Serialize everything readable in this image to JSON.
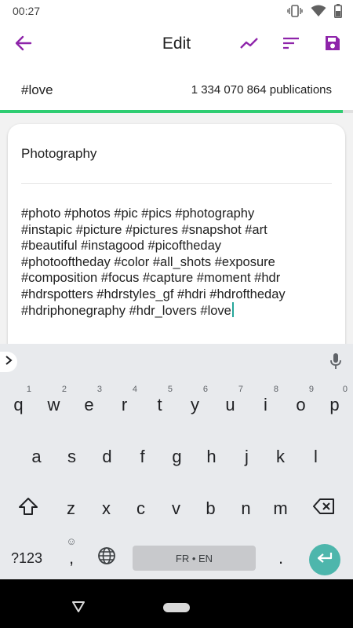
{
  "status_bar": {
    "time": "00:27",
    "icons": [
      "vibrate-icon",
      "wifi-icon",
      "battery-icon"
    ]
  },
  "app_bar": {
    "title": "Edit",
    "accent_color": "#8e24aa",
    "actions": [
      "back-arrow-icon",
      "trending-icon",
      "sort-icon",
      "save-icon"
    ]
  },
  "hashtag": {
    "name": "#love",
    "publications": "1 334 070 864 publications",
    "progress_fraction": 0.97,
    "progress_color": "#2ecc71"
  },
  "card": {
    "title": "Photography",
    "lines": [
      "#photo #photos #pic #pics #photography",
      "#instapic #picture #pictures #snapshot #art",
      "#beautiful #instagood #picoftheday",
      "#photooftheday #color #all_shots #exposure",
      "#composition #focus #capture #moment #hdr",
      "#hdrspotters #hdrstyles_gf #hdri #hdroftheday",
      "#hdriphonegraphy #hdr_lovers #love"
    ]
  },
  "keyboard": {
    "row1": [
      {
        "label": "q",
        "hint": "1"
      },
      {
        "label": "w",
        "hint": "2"
      },
      {
        "label": "e",
        "hint": "3"
      },
      {
        "label": "r",
        "hint": "4"
      },
      {
        "label": "t",
        "hint": "5"
      },
      {
        "label": "y",
        "hint": "6"
      },
      {
        "label": "u",
        "hint": "7"
      },
      {
        "label": "i",
        "hint": "8"
      },
      {
        "label": "o",
        "hint": "9"
      },
      {
        "label": "p",
        "hint": "0"
      }
    ],
    "row2": [
      "a",
      "s",
      "d",
      "f",
      "g",
      "h",
      "j",
      "k",
      "l"
    ],
    "row3": [
      "z",
      "x",
      "c",
      "v",
      "b",
      "n",
      "m"
    ],
    "symbols_label": "?123",
    "comma_label": ",",
    "period_label": ".",
    "space_label": "FR • EN",
    "enter_color": "#4db6ac"
  }
}
